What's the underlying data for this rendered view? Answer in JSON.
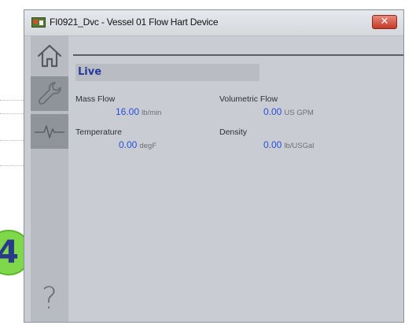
{
  "window": {
    "title": "FI0921_Dvc - Vessel 01 Flow Hart Device",
    "close_label": "✕"
  },
  "step_badge": "4",
  "nav": {
    "items": [
      {
        "name": "home",
        "icon": "home-icon"
      },
      {
        "name": "maintenance",
        "icon": "wrench-icon"
      },
      {
        "name": "trend",
        "icon": "trend-icon"
      },
      {
        "name": "help",
        "icon": "help-icon",
        "glyph": "?"
      }
    ]
  },
  "live": {
    "header": "Live",
    "fields": [
      {
        "label": "Mass Flow",
        "value": "16.00",
        "unit": "lb/min"
      },
      {
        "label": "Volumetric Flow",
        "value": "0.00",
        "unit": "US GPM"
      },
      {
        "label": "Temperature",
        "value": "0.00",
        "unit": "degF"
      },
      {
        "label": "Density",
        "value": "0.00",
        "unit": "lb/USGal"
      }
    ]
  },
  "colors": {
    "value": "#2a4fd6",
    "header_text": "#243a9c",
    "window_bg": "#c9cdd3",
    "close_button": "#c23b26"
  }
}
